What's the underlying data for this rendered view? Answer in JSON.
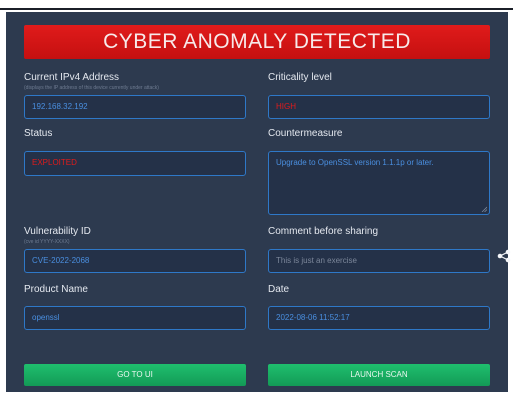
{
  "banner": {
    "title": "CYBER ANOMALY DETECTED"
  },
  "ipv4": {
    "label": "Current IPv4 Address",
    "hint": "(displays the IP address of this device currently under attack)",
    "value": "192.168.32.192"
  },
  "criticality": {
    "label": "Criticality level",
    "value": "HIGH"
  },
  "status": {
    "label": "Status",
    "value": "EXPLOITED"
  },
  "countermeasure": {
    "label": "Countermeasure",
    "value": "Upgrade to OpenSSL version 1.1.1p or later."
  },
  "vulnerability": {
    "label": "Vulnerability ID",
    "hint": "(cve id YYYY-XXXX)",
    "value": "CVE-2022-2068"
  },
  "comment": {
    "label": "Comment before sharing",
    "placeholder": "This is just an exercise"
  },
  "product": {
    "label": "Product Name",
    "value": "openssl"
  },
  "date": {
    "label": "Date",
    "value": "2022-08-06 11:52:17"
  },
  "buttons": {
    "go_to_ui": "GO TO UI",
    "launch_scan": "LAUNCH SCAN"
  },
  "icons": {
    "share": "share-icon"
  },
  "colors": {
    "banner": "#e01b1b",
    "accent": "#2e78c8",
    "panel": "#2d3a4f",
    "button": "#1fbf6e",
    "alert_text": "#e21b1b"
  }
}
